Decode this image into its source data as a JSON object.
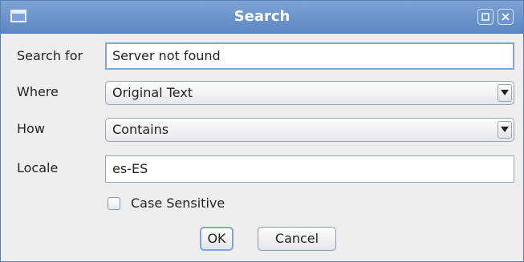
{
  "window": {
    "title": "Search"
  },
  "form": {
    "search_for": {
      "label": "Search for",
      "value": "Server not found"
    },
    "where": {
      "label": "Where",
      "selected": "Original Text"
    },
    "how": {
      "label": "How",
      "selected": "Contains"
    },
    "locale": {
      "label": "Locale",
      "value": "es-ES"
    },
    "case_sensitive": {
      "label": "Case Sensitive",
      "checked": false
    }
  },
  "buttons": {
    "ok": "OK",
    "cancel": "Cancel"
  },
  "colors": {
    "titlebar": "#5b87c5",
    "focus_ring": "#7fa6d8"
  },
  "icons": {
    "window_menu": "window-menu-icon",
    "maximize": "maximize-icon",
    "close": "close-icon",
    "combo_arrow": "chevron-down-icon"
  }
}
